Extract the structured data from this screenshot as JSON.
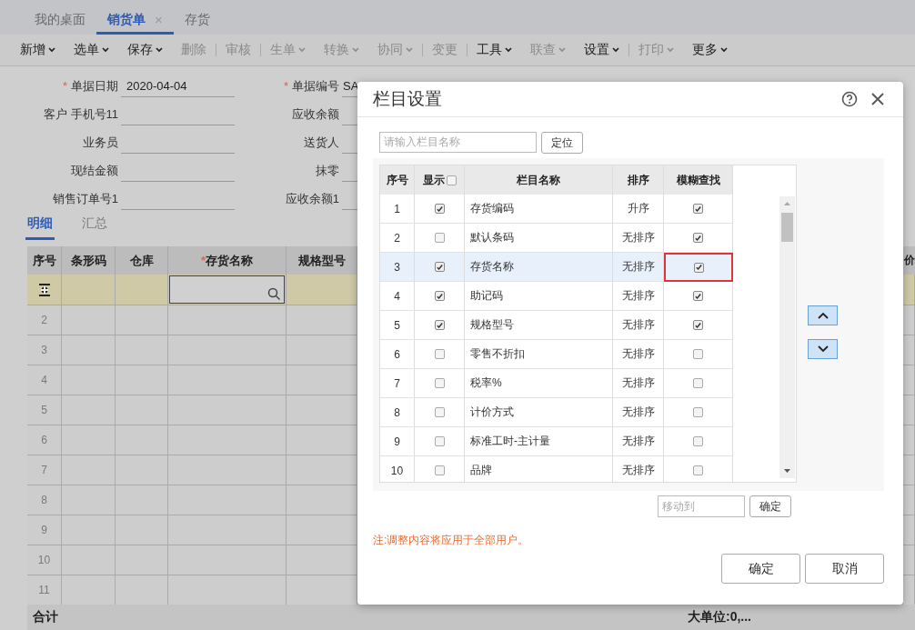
{
  "tabs": [
    {
      "label": "我的桌面",
      "selected": false
    },
    {
      "label": "销货单",
      "selected": true,
      "close": "×"
    },
    {
      "label": "存货",
      "selected": false
    }
  ],
  "toolbar": [
    {
      "label": "新增",
      "dropdown": true,
      "disabled": false,
      "divider": false
    },
    {
      "label": "选单",
      "dropdown": true,
      "disabled": false,
      "divider": false
    },
    {
      "label": "保存",
      "dropdown": true,
      "disabled": false,
      "divider": false
    },
    {
      "label": "删除",
      "dropdown": false,
      "disabled": true,
      "divider": true
    },
    {
      "label": "审核",
      "dropdown": false,
      "disabled": true,
      "divider": true
    },
    {
      "label": "生单",
      "dropdown": true,
      "disabled": true,
      "divider": false
    },
    {
      "label": "转换",
      "dropdown": true,
      "disabled": true,
      "divider": false
    },
    {
      "label": "协同",
      "dropdown": true,
      "disabled": true,
      "divider": true
    },
    {
      "label": "变更",
      "dropdown": false,
      "disabled": true,
      "divider": true
    },
    {
      "label": "工具",
      "dropdown": true,
      "disabled": false,
      "divider": false
    },
    {
      "label": "联查",
      "dropdown": true,
      "disabled": true,
      "divider": false
    },
    {
      "label": "设置",
      "dropdown": true,
      "disabled": false,
      "divider": true
    },
    {
      "label": "打印",
      "dropdown": true,
      "disabled": true,
      "divider": false
    },
    {
      "label": "更多",
      "dropdown": true,
      "disabled": false,
      "divider": false
    }
  ],
  "form": [
    [
      {
        "label": "单据日期",
        "required": true,
        "value": "2020-04-04"
      },
      {
        "label": "单据编号",
        "required": true,
        "value": "SA"
      }
    ],
    [
      {
        "label": "客户 手机号11",
        "required": false
      },
      {
        "label": "应收余额",
        "required": false
      }
    ],
    [
      {
        "label": "业务员",
        "required": false
      },
      {
        "label": "送货人",
        "required": false
      }
    ],
    [
      {
        "label": "现结金额",
        "required": false
      },
      {
        "label": "抹零",
        "required": false
      }
    ],
    [
      {
        "label": "销售订单号1",
        "required": false
      },
      {
        "label": "应收余额1",
        "required": false
      }
    ]
  ],
  "detail_tabs": [
    {
      "label": "明细",
      "selected": true
    },
    {
      "label": "汇总",
      "selected": false
    }
  ],
  "grid": {
    "columns": [
      {
        "label": "序号"
      },
      {
        "label": "条形码"
      },
      {
        "label": "仓库"
      },
      {
        "label": "存货名称",
        "star": "*"
      },
      {
        "label": "规格型号"
      },
      {
        "label": "价"
      }
    ],
    "rows": [
      "2",
      "3",
      "4",
      "5",
      "6",
      "7",
      "8",
      "9",
      "10",
      "11"
    ],
    "total_label": "合计",
    "total_value": "大单位:0,..."
  },
  "dialog": {
    "title": "栏目设置",
    "search_placeholder": "请输入栏目名称",
    "locate": "定位",
    "columns": {
      "no": "序号",
      "show": "显示",
      "name": "栏目名称",
      "sort": "排序",
      "fuzzy": "模糊查找"
    },
    "show_all": false,
    "rows": [
      {
        "no": "1",
        "show": true,
        "name": "存货编码",
        "sort": "升序",
        "fuzzy": true,
        "selected": false,
        "marked": false
      },
      {
        "no": "2",
        "show": false,
        "name": "默认条码",
        "sort": "无排序",
        "fuzzy": true,
        "selected": false,
        "marked": false
      },
      {
        "no": "3",
        "show": true,
        "name": "存货名称",
        "sort": "无排序",
        "fuzzy": true,
        "selected": true,
        "marked": true
      },
      {
        "no": "4",
        "show": true,
        "name": "助记码",
        "sort": "无排序",
        "fuzzy": true,
        "selected": false,
        "marked": false
      },
      {
        "no": "5",
        "show": true,
        "name": "规格型号",
        "sort": "无排序",
        "fuzzy": true,
        "selected": false,
        "marked": false
      },
      {
        "no": "6",
        "show": false,
        "name": "零售不折扣",
        "sort": "无排序",
        "fuzzy": false,
        "selected": false,
        "marked": false
      },
      {
        "no": "7",
        "show": false,
        "name": "税率%",
        "sort": "无排序",
        "fuzzy": false,
        "selected": false,
        "marked": false
      },
      {
        "no": "8",
        "show": false,
        "name": "计价方式",
        "sort": "无排序",
        "fuzzy": false,
        "selected": false,
        "marked": false
      },
      {
        "no": "9",
        "show": false,
        "name": "标准工时-主计量",
        "sort": "无排序",
        "fuzzy": false,
        "selected": false,
        "marked": false
      },
      {
        "no": "10",
        "show": false,
        "name": "品牌",
        "sort": "无排序",
        "fuzzy": false,
        "selected": false,
        "marked": false
      }
    ],
    "move_placeholder": "移动到",
    "move_ok": "确定",
    "note": "注:调整内容将应用于全部用户。",
    "ok": "确定",
    "cancel": "取消"
  }
}
